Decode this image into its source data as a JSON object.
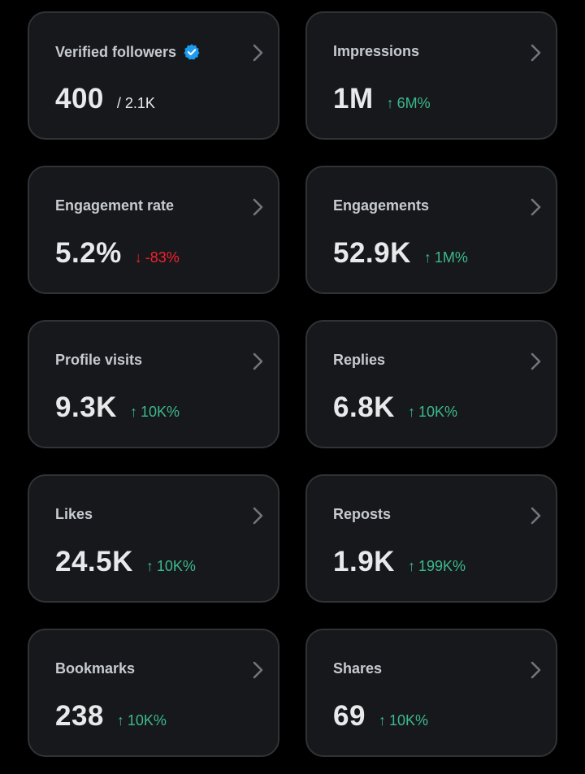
{
  "colors": {
    "background": "#000000",
    "card_background": "#16181c",
    "card_border": "#2f3336",
    "positive": "#3cb98a",
    "negative": "#f4212e",
    "verified": "#1d9bf0"
  },
  "cards": [
    {
      "title": "Verified followers",
      "value": "400",
      "sub": "/ 2.1K",
      "delta": "",
      "trend": "none",
      "icon": "verified-badge-icon"
    },
    {
      "title": "Impressions",
      "value": "1M",
      "sub": "",
      "delta": "6M%",
      "trend": "up"
    },
    {
      "title": "Engagement rate",
      "value": "5.2%",
      "sub": "",
      "delta": "-83%",
      "trend": "down"
    },
    {
      "title": "Engagements",
      "value": "52.9K",
      "sub": "",
      "delta": "1M%",
      "trend": "up"
    },
    {
      "title": "Profile visits",
      "value": "9.3K",
      "sub": "",
      "delta": "10K%",
      "trend": "up"
    },
    {
      "title": "Replies",
      "value": "6.8K",
      "sub": "",
      "delta": "10K%",
      "trend": "up"
    },
    {
      "title": "Likes",
      "value": "24.5K",
      "sub": "",
      "delta": "10K%",
      "trend": "up"
    },
    {
      "title": "Reposts",
      "value": "1.9K",
      "sub": "",
      "delta": "199K%",
      "trend": "up"
    },
    {
      "title": "Bookmarks",
      "value": "238",
      "sub": "",
      "delta": "10K%",
      "trend": "up"
    },
    {
      "title": "Shares",
      "value": "69",
      "sub": "",
      "delta": "10K%",
      "trend": "up"
    }
  ]
}
